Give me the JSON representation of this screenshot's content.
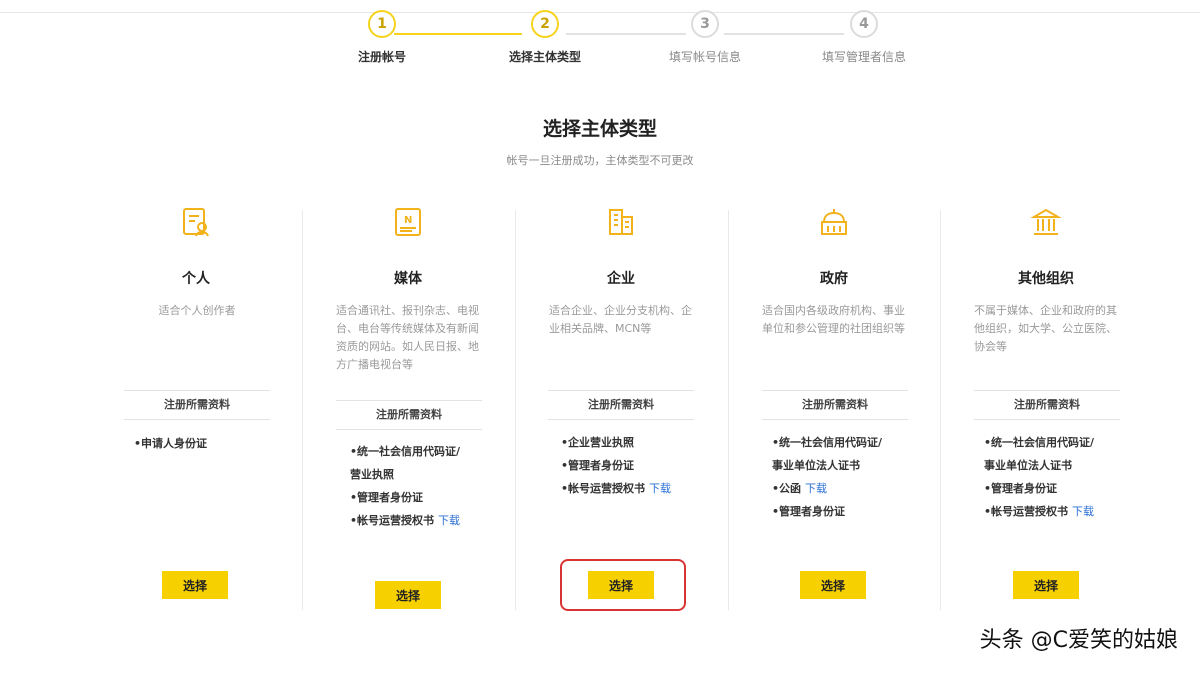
{
  "stepper": {
    "steps": [
      {
        "number": "1",
        "label": "注册帐号"
      },
      {
        "number": "2",
        "label": "选择主体类型"
      },
      {
        "number": "3",
        "label": "填写帐号信息"
      },
      {
        "number": "4",
        "label": "填写管理者信息"
      }
    ]
  },
  "page": {
    "title": "选择主体类型",
    "subtitle": "帐号一旦注册成功，主体类型不可更改"
  },
  "colors": {
    "accent": "#f7d000",
    "link": "#2a6fd6",
    "highlight": "#d93434"
  },
  "cards": [
    {
      "icon": "id-card-person-icon",
      "name": "个人",
      "desc": "适合个人创作者",
      "req_title": "注册所需资料",
      "items": [
        {
          "text": "•申请人身份证",
          "link": ""
        }
      ],
      "button": "选择"
    },
    {
      "icon": "newspaper-icon",
      "name": "媒体",
      "desc": "适合通讯社、报刊杂志、电视台、电台等传统媒体及有新闻资质的网站。如人民日报、地方广播电视台等",
      "req_title": "注册所需资料",
      "items": [
        {
          "text": "•统一社会信用代码证/",
          "link": ""
        },
        {
          "text": "营业执照",
          "link": ""
        },
        {
          "text": "•管理者身份证",
          "link": ""
        },
        {
          "text": "•帐号运营授权书",
          "link": "下载"
        }
      ],
      "button": "选择"
    },
    {
      "icon": "building-icon",
      "name": "企业",
      "desc": "适合企业、企业分支机构、企业相关品牌、MCN等",
      "req_title": "注册所需资料",
      "items": [
        {
          "text": "•企业营业执照",
          "link": ""
        },
        {
          "text": "•管理者身份证",
          "link": ""
        },
        {
          "text": "•帐号运营授权书",
          "link": "下载"
        }
      ],
      "button": "选择"
    },
    {
      "icon": "government-building-icon",
      "name": "政府",
      "desc": "适合国内各级政府机构、事业单位和参公管理的社团组织等",
      "req_title": "注册所需资料",
      "items": [
        {
          "text": "•统一社会信用代码证/",
          "link": ""
        },
        {
          "text": "事业单位法人证书",
          "link": ""
        },
        {
          "text": "•公函",
          "link": "下载"
        },
        {
          "text": "•管理者身份证",
          "link": ""
        }
      ],
      "button": "选择"
    },
    {
      "icon": "institution-columns-icon",
      "name": "其他组织",
      "desc": "不属于媒体、企业和政府的其他组织，如大学、公立医院、协会等",
      "req_title": "注册所需资料",
      "items": [
        {
          "text": "•统一社会信用代码证/",
          "link": ""
        },
        {
          "text": "事业单位法人证书",
          "link": ""
        },
        {
          "text": "•管理者身份证",
          "link": ""
        },
        {
          "text": "•帐号运营授权书",
          "link": "下载"
        }
      ],
      "button": "选择"
    }
  ],
  "watermark": "头条 @C爱笑的姑娘"
}
